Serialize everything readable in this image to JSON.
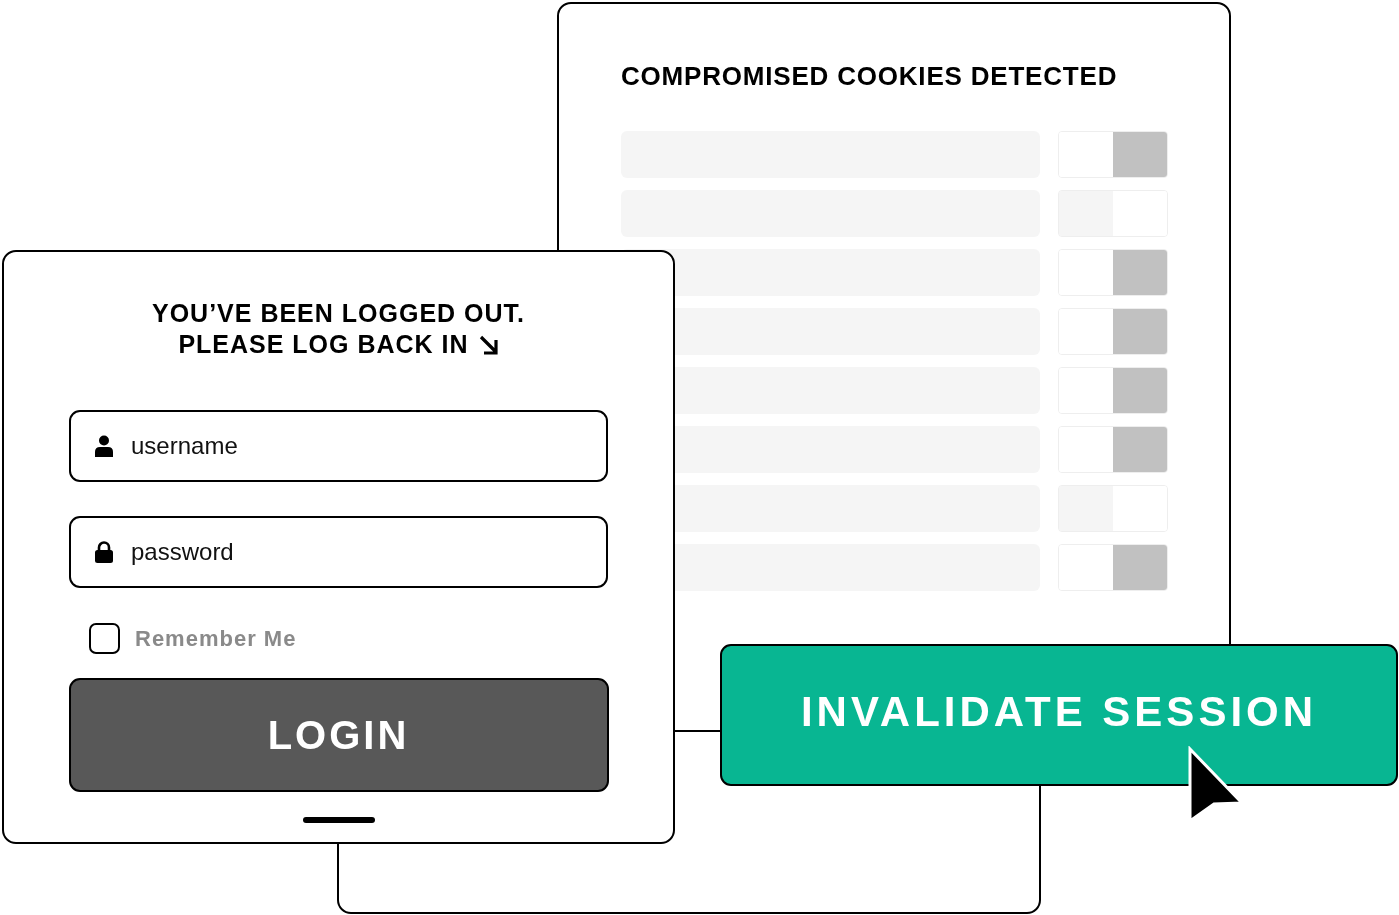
{
  "cookies_panel": {
    "title": "COMPROMISED COOKIES DETECTED",
    "rows": [
      {
        "on": true
      },
      {
        "on": false
      },
      {
        "on": true
      },
      {
        "on": true
      },
      {
        "on": true
      },
      {
        "on": true
      },
      {
        "on": false
      },
      {
        "on": true
      }
    ]
  },
  "login_panel": {
    "heading_lines": [
      "YOU’VE BEEN LOGGED OUT.",
      "PLEASE LOG BACK IN"
    ],
    "fields": [
      {
        "kind": "username",
        "placeholder": "username"
      },
      {
        "kind": "password",
        "placeholder": "password"
      }
    ],
    "remember_me": {
      "label": "Remember Me",
      "checked": false
    },
    "button": "LOGIN"
  },
  "invalidate_button": "INVALIDATE SESSION"
}
